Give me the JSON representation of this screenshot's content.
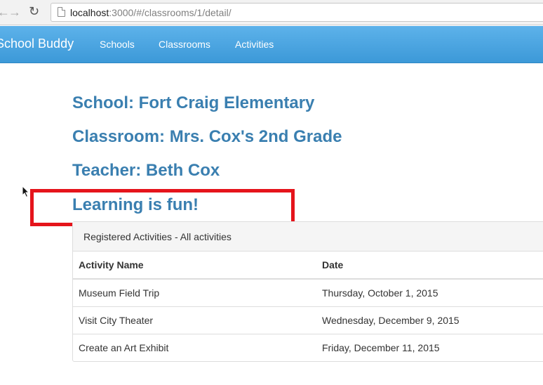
{
  "browser": {
    "url_host": "localhost",
    "url_path": ":3000/#/classrooms/1/detail/"
  },
  "navbar": {
    "brand": "School Buddy",
    "links": [
      "Schools",
      "Classrooms",
      "Activities"
    ]
  },
  "detail": {
    "school": "School: Fort Craig Elementary",
    "classroom": "Classroom: Mrs. Cox's 2nd Grade",
    "teacher": "Teacher: Beth Cox",
    "motto": "Learning is fun!"
  },
  "highlight_color": "#e5141b",
  "accent_color": "#3a7fb0",
  "navbar_color": "#4aa6e2",
  "activities": {
    "heading": "Registered Activities - All activities",
    "columns": [
      "Activity Name",
      "Date"
    ],
    "rows": [
      [
        "Museum Field Trip",
        "Thursday, October 1, 2015"
      ],
      [
        "Visit City Theater",
        "Wednesday, December 9, 2015"
      ],
      [
        "Create an Art Exhibit",
        "Friday, December 11, 2015"
      ]
    ]
  }
}
